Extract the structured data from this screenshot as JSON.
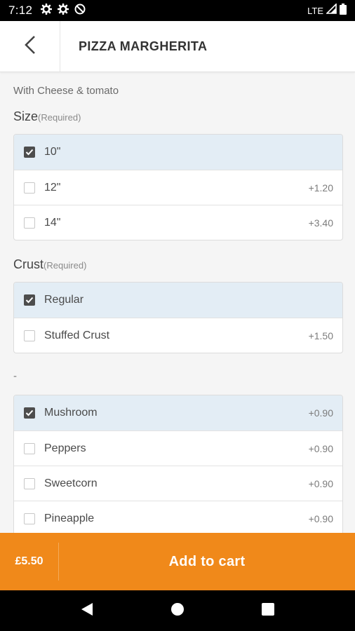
{
  "status": {
    "time": "7:12",
    "network": "LTE"
  },
  "header": {
    "title": "PIZZA MARGHERITA"
  },
  "description": "With Cheese & tomato",
  "size": {
    "title": "Size",
    "required": "(Required)",
    "options": [
      {
        "label": "10\"",
        "price": "",
        "checked": true
      },
      {
        "label": "12\"",
        "price": "+1.20",
        "checked": false
      },
      {
        "label": "14\"",
        "price": "+3.40",
        "checked": false
      }
    ]
  },
  "crust": {
    "title": "Crust",
    "required": "(Required)",
    "options": [
      {
        "label": "Regular",
        "price": "",
        "checked": true
      },
      {
        "label": "Stuffed Crust",
        "price": "+1.50",
        "checked": false
      }
    ]
  },
  "extras": {
    "title": "-",
    "options": [
      {
        "label": "Mushroom",
        "price": "+0.90",
        "checked": true
      },
      {
        "label": "Peppers",
        "price": "+0.90",
        "checked": false
      },
      {
        "label": "Sweetcorn",
        "price": "+0.90",
        "checked": false
      },
      {
        "label": "Pineapple",
        "price": "+0.90",
        "checked": false
      }
    ]
  },
  "cart": {
    "price": "£5.50",
    "button_label": "Add to cart"
  },
  "colors": {
    "accent": "#f0891a",
    "selected_row": "#e3edf5"
  }
}
